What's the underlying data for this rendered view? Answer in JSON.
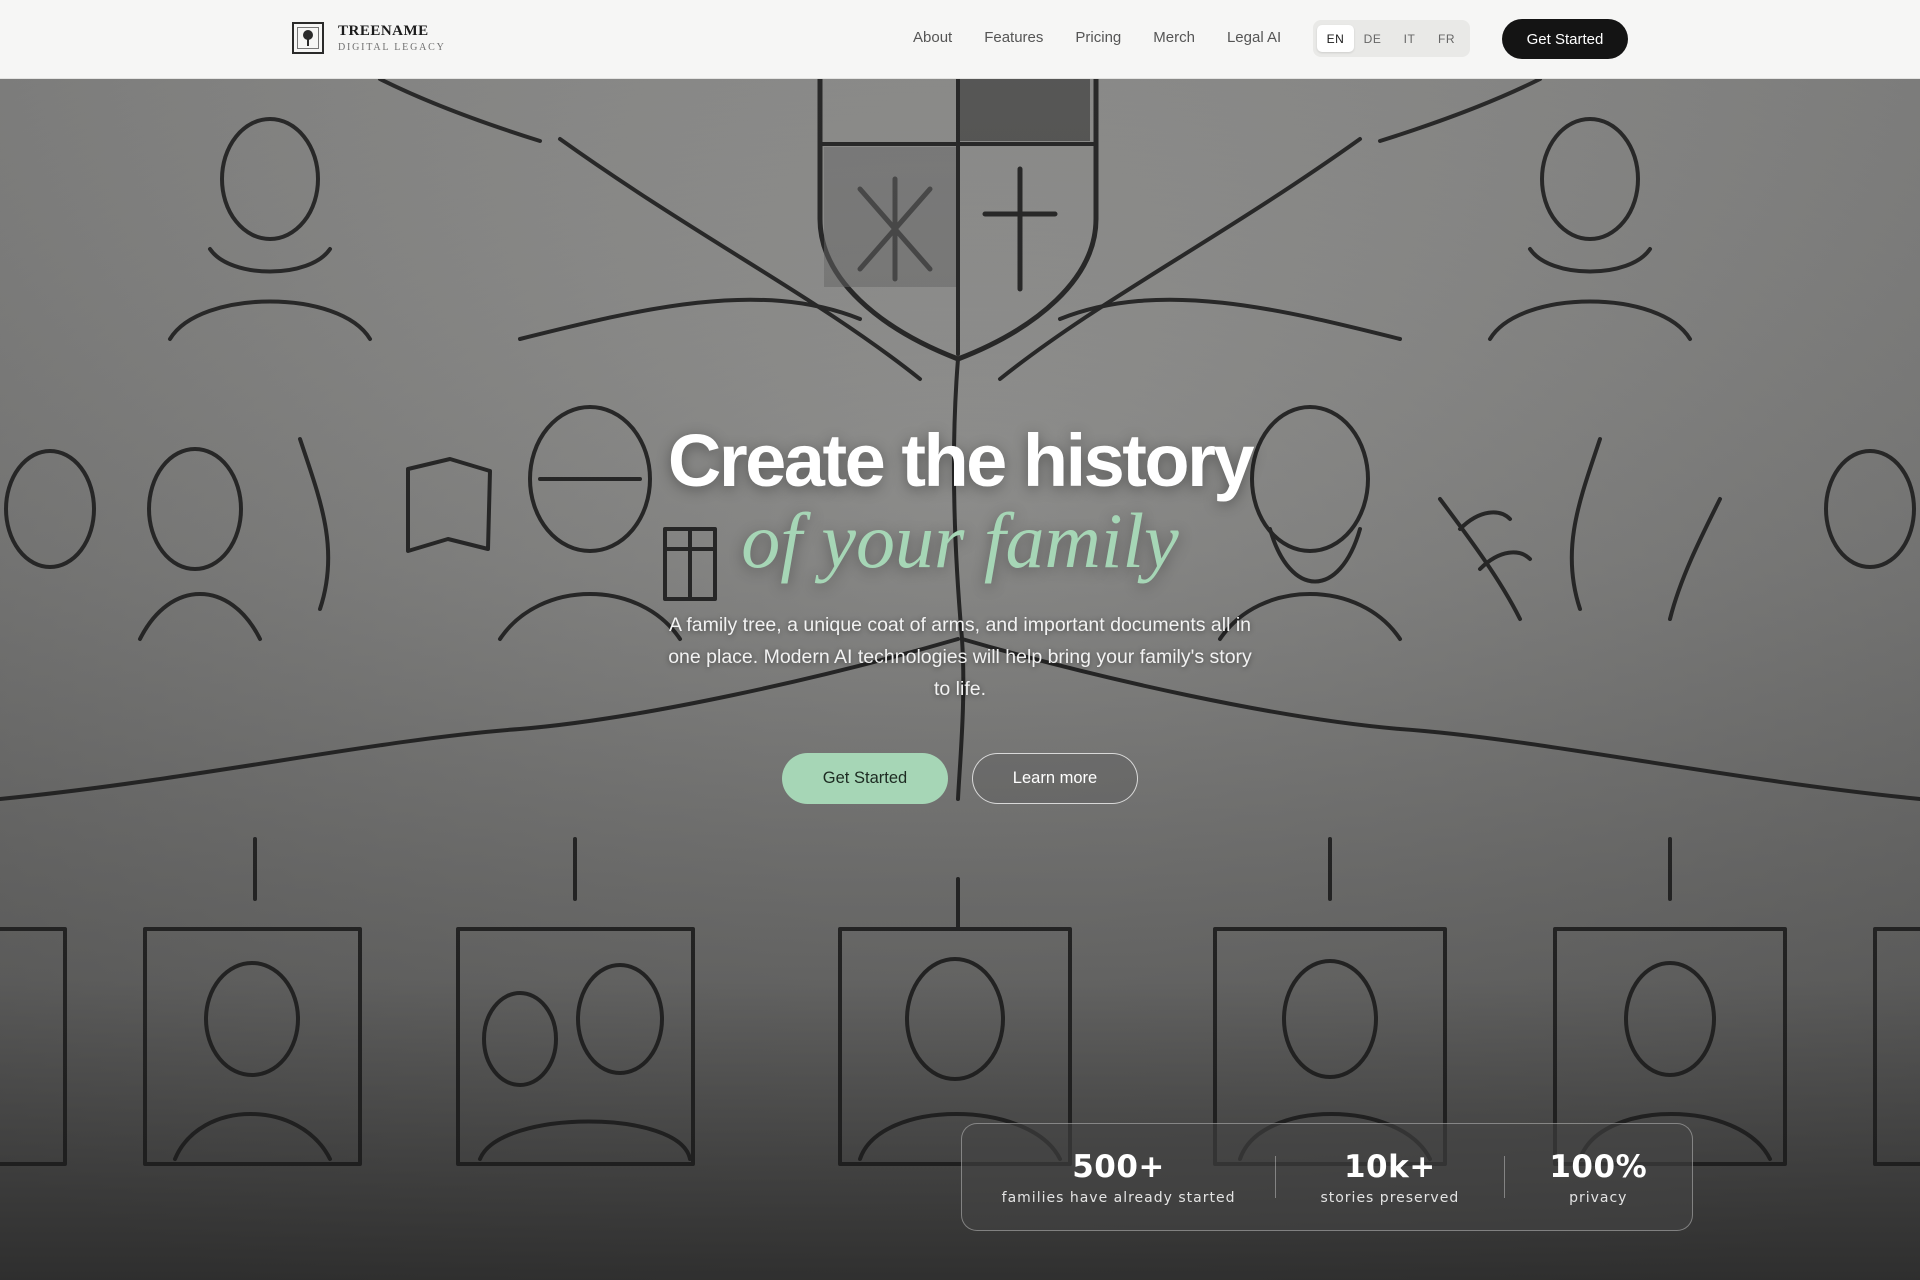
{
  "brand": {
    "name": "TREENAME",
    "tagline": "DIGITAL LEGACY",
    "logo_icon": "tree-icon"
  },
  "nav": {
    "items": [
      {
        "label": "About"
      },
      {
        "label": "Features"
      },
      {
        "label": "Pricing"
      },
      {
        "label": "Merch"
      },
      {
        "label": "Legal AI"
      }
    ]
  },
  "languages": {
    "options": [
      "EN",
      "DE",
      "IT",
      "FR"
    ],
    "selected": "EN"
  },
  "header_cta": "Get Started",
  "hero": {
    "title": "Create the history",
    "accent": "of your family",
    "description": "A family tree, a unique coat of arms, and important documents all in one place. Modern AI technologies will help bring your family's story to life.",
    "primary_cta": "Get Started",
    "secondary_cta": "Learn more",
    "background": "pencil-sketch-family-tree-image"
  },
  "stats": [
    {
      "value": "500+",
      "label": "families have already started"
    },
    {
      "value": "10k+",
      "label": "stories preserved"
    },
    {
      "value": "100%",
      "label": "privacy"
    }
  ],
  "colors": {
    "accent": "#a6d6b6",
    "header_bg": "#f6f6f5",
    "cta_dark": "#141414"
  }
}
